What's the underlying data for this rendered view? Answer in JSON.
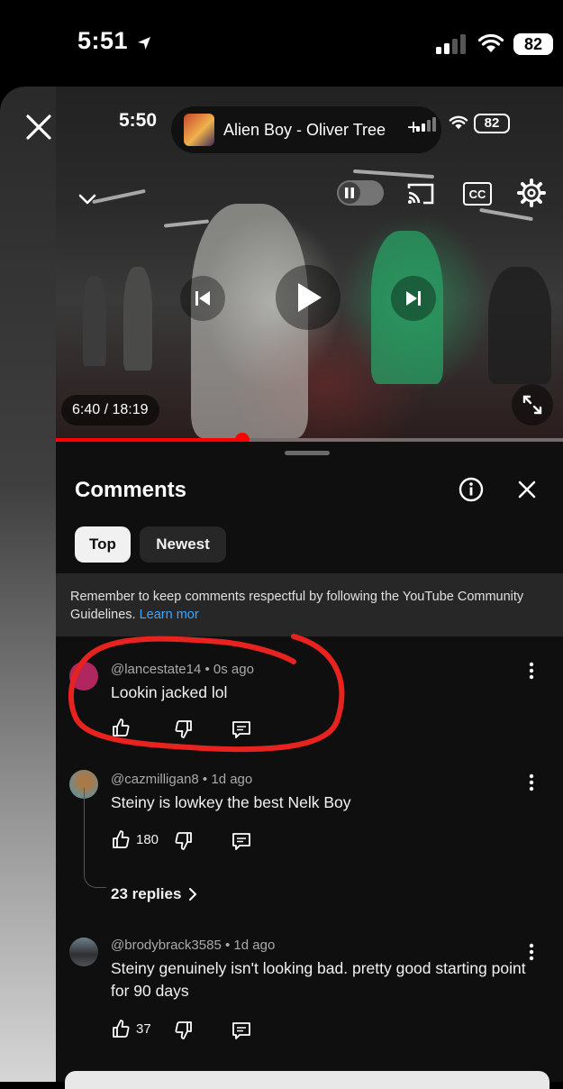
{
  "status_bar": {
    "time": "5:51",
    "battery": "82"
  },
  "mini_player": {
    "time": "5:50",
    "song": "Alien Boy - Oliver Tree",
    "battery": "82"
  },
  "video": {
    "timecode": "6:40 / 18:19",
    "progress": 0.367
  },
  "comments_panel": {
    "title": "Comments",
    "tabs": [
      {
        "label": "Top",
        "selected": true
      },
      {
        "label": "Newest",
        "selected": false
      }
    ],
    "guidelines": "Remember to keep comments respectful by following the YouTube Community Guidelines.",
    "learn_more": "Learn mor",
    "comments": [
      {
        "author": "@lancestate14",
        "time": "0s ago",
        "text": "Lookin jacked lol",
        "likes": ""
      },
      {
        "author": "@cazmilligan8",
        "time": "1d ago",
        "text": "Steiny is lowkey the best Nelk Boy",
        "likes": "180",
        "replies": "23 replies"
      },
      {
        "author": "@brodybrack3585",
        "time": "1d ago",
        "text": "Steiny genuinely isn't looking bad. pretty good starting point for 90 days",
        "likes": "37"
      }
    ]
  },
  "colors": {
    "accent": "#ff0000",
    "link": "#3ea6ff",
    "annotation": "#e8231f"
  }
}
